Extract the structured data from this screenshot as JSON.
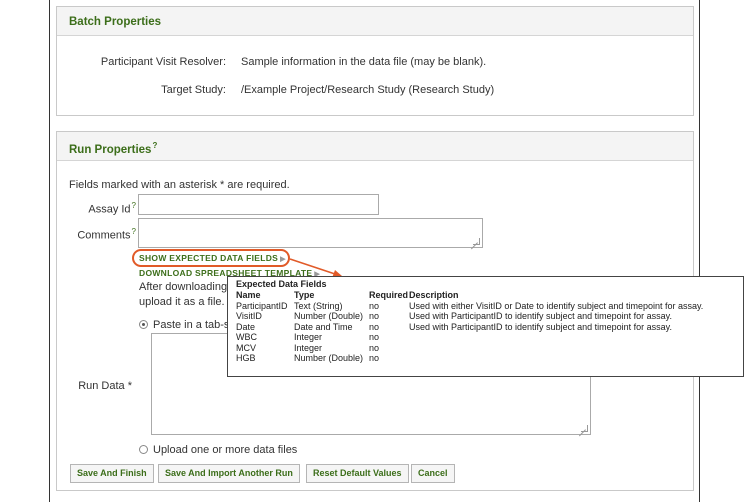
{
  "batch": {
    "title": "Batch Properties",
    "resolver_label": "Participant Visit Resolver:",
    "resolver_value": "Sample information in the data file (may be blank).",
    "target_label": "Target Study:",
    "target_value": "/Example Project/Research Study (Research Study)"
  },
  "run": {
    "title": "Run Properties",
    "help_mark": "?",
    "required_note": "Fields marked with an asterisk * are required.",
    "assay_id_label": "Assay Id",
    "assay_id_value": "",
    "comments_label": "Comments",
    "comments_value": "",
    "show_fields_link": "SHOW EXPECTED DATA FIELDS",
    "download_link": "DOWNLOAD SPREADSHEET TEMPLATE",
    "after_download_text": "After downloading",
    "upload_text": "upload it as a file.",
    "paste_option": "Paste in a tab-s",
    "run_data_label": "Run Data *",
    "upload_option": "Upload one or more data files"
  },
  "expected_fields": {
    "title": "Expected Data Fields",
    "headers": [
      "Name",
      "Type",
      "Required",
      "Description"
    ],
    "rows": [
      [
        "ParticipantID",
        "Text (String)",
        "no",
        "Used with either VisitID or Date to identify subject and timepoint for assay."
      ],
      [
        "VisitID",
        "Number (Double)",
        "no",
        "Used with ParticipantID to identify subject and timepoint for assay."
      ],
      [
        "Date",
        "Date and Time",
        "no",
        "Used with ParticipantID to identify subject and timepoint for assay."
      ],
      [
        "WBC",
        "Integer",
        "no",
        ""
      ],
      [
        "MCV",
        "Integer",
        "no",
        ""
      ],
      [
        "HGB",
        "Number (Double)",
        "no",
        ""
      ]
    ]
  },
  "buttons": {
    "save_finish": "Save And Finish",
    "save_import": "Save And Import Another Run",
    "reset": "Reset Default Values",
    "cancel": "Cancel"
  },
  "colors": {
    "accent_green": "#3c6e1a",
    "callout_orange": "#e15a28"
  },
  "icons": {
    "help": "question-mark",
    "link_arrow": "triangle-right",
    "callout": "arrow"
  }
}
